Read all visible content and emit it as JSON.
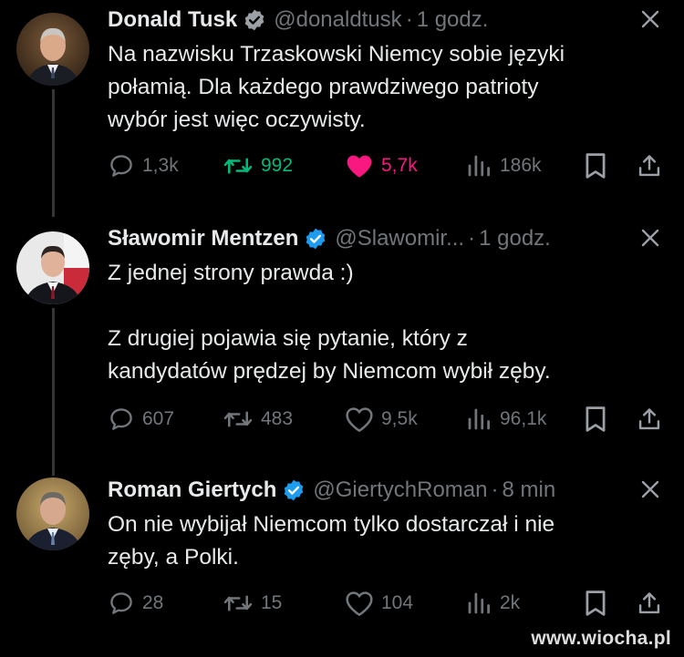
{
  "tweets": [
    {
      "name": "Donald Tusk",
      "handle": "@donaldtusk",
      "separator": "·",
      "time": "1 godz.",
      "text": "Na nazwisku Trzaskowski Niemcy sobie języki\npołamią. Dla każdego prawdziwego patrioty\nwybór jest więc oczywisty.",
      "replies": "1,3k",
      "retweets": "992",
      "likes": "5,7k",
      "views": "186k",
      "retweeted": true,
      "liked": true
    },
    {
      "name": "Sławomir Mentzen",
      "handle": "@Slawomir...",
      "separator": "·",
      "time": "1 godz.",
      "text": "Z jednej strony prawda :)\n\nZ drugiej pojawia się pytanie, który z\nkandydatów prędzej by Niemcom wybił zęby.",
      "replies": "607",
      "retweets": "483",
      "likes": "9,5k",
      "views": "96,1k",
      "retweeted": false,
      "liked": false
    },
    {
      "name": "Roman Giertych",
      "handle": "@GiertychRoman",
      "separator": "·",
      "time": "8 min",
      "text": "On nie wybijał Niemcom tylko dostarczał i nie\nzęby, a Polki.",
      "replies": "28",
      "retweets": "15",
      "likes": "104",
      "views": "2k",
      "retweeted": false,
      "liked": false
    }
  ],
  "watermark": "www.wiocha.pl",
  "colors": {
    "background": "#000000",
    "text": "#e7e9ea",
    "muted": "#71767b",
    "verified": "#1d9bf0",
    "retweet_active": "#00ba7c",
    "like_active": "#f91880"
  },
  "icons": [
    "verified-badge-icon",
    "close-icon",
    "reply-icon",
    "retweet-icon",
    "like-icon",
    "views-icon",
    "bookmark-icon",
    "share-icon"
  ]
}
